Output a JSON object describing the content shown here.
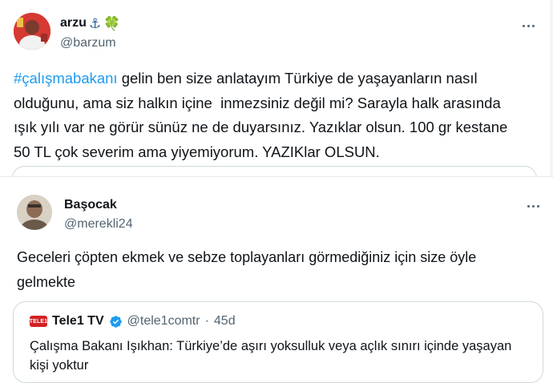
{
  "tweet1": {
    "display_name": "arzu",
    "name_emojis": [
      "⚓",
      "🍀"
    ],
    "handle": "@barzum",
    "hashtag": "#çalışmabakanı",
    "body": " gelin ben size anlatayım Türkiye de yaşayanların nasıl olduğunu, ama siz halkın içine  inmezsiniz değil mi? Sarayla halk arasında ışık yılı var ne görür sünüz ne de duyarsınız. Yazıklar olsun. 100 gr kestane 50 TL çok severim ama yiyemiyorum. YAZIKlar OLSUN.",
    "more_icon": "more-horizontal-icon"
  },
  "tweet2": {
    "display_name": "Başocak",
    "handle": "@merekli24",
    "body": "Geceleri çöpten ekmek ve sebze toplayanları görmediğiniz için size öyle gelmekte",
    "more_icon": "more-horizontal-icon",
    "quote": {
      "logo_text": "TELE1",
      "name": "Tele1 TV",
      "handle": "@tele1comtr",
      "separator": "·",
      "time": "45d",
      "text": "Çalışma Bakanı Işıkhan: Türkiye’de aşırı yoksulluk veya açlık sınırı içinde yaşayan kişi yoktur"
    }
  },
  "colors": {
    "hashtag": "#1d9bf0",
    "secondary_text": "#536471",
    "verified": "#1d9bf0",
    "border": "#cfd9de"
  }
}
